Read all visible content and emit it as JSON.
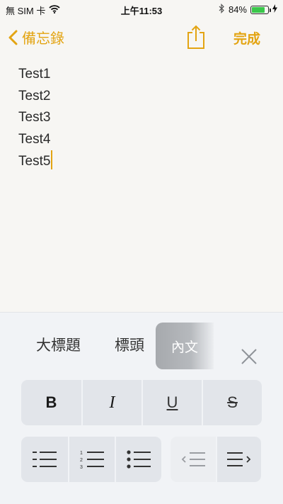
{
  "status_bar": {
    "carrier": "無 SIM 卡",
    "time": "上午11:53",
    "battery_percent": "84%",
    "battery_level": 0.84,
    "battery_color": "#3ac74a"
  },
  "nav": {
    "back_label": "備忘錄",
    "done_label": "完成",
    "accent_color": "#e3a412"
  },
  "note": {
    "lines": [
      "Test1",
      "Test2",
      "Test3",
      "Test4",
      "Test5"
    ]
  },
  "format_panel": {
    "styles": [
      "大標題",
      "標頭",
      "內文"
    ],
    "selected_style": "內文",
    "text_buttons": [
      "B",
      "I",
      "U",
      "S"
    ],
    "list_buttons": [
      "dashed-list-icon",
      "numbered-list-icon",
      "bulleted-list-icon"
    ],
    "indent_buttons": [
      "outdent-icon",
      "indent-icon"
    ]
  }
}
